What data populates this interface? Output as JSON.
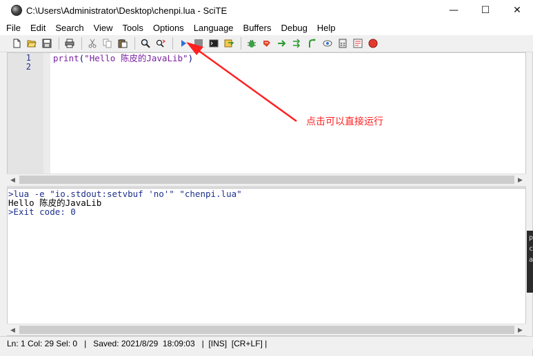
{
  "window": {
    "title": "C:\\Users\\Administrator\\Desktop\\chenpi.lua - SciTE",
    "minimize_glyph": "—",
    "maximize_glyph": "☐",
    "close_glyph": "✕"
  },
  "menu": {
    "items": [
      "File",
      "Edit",
      "Search",
      "View",
      "Tools",
      "Options",
      "Language",
      "Buffers",
      "Debug",
      "Help"
    ]
  },
  "toolbar": {
    "buttons": [
      "new-file-icon",
      "open-folder-icon",
      "save-icon",
      "print-icon",
      "cut-icon",
      "copy-icon",
      "paste-icon",
      "find-icon",
      "replace-icon",
      "run-icon",
      "stop-icon",
      "console-icon",
      "compile-icon",
      "build-icon",
      "go-icon",
      "next-message-icon",
      "jump-icon",
      "view-icon",
      "eye-icon",
      "calculator-icon",
      "macro-icon",
      "record-icon"
    ],
    "colors": {
      "run": "#2f6fd6",
      "stop": "#8a8a8a",
      "record": "#e23b2e",
      "bug": "#3aa245"
    }
  },
  "editor": {
    "line_numbers": [
      "1",
      "2"
    ],
    "code": {
      "keyword": "print",
      "open_paren": "(",
      "string": "\"Hello 陈皮的JavaLib\"",
      "close_paren": ")"
    }
  },
  "output": {
    "lines": [
      {
        "text": ">lua -e \"io.stdout:setvbuf 'no'\" \"chenpi.lua\"",
        "kind": "command"
      },
      {
        "text": "Hello 陈皮的JavaLib",
        "kind": "text"
      },
      {
        "text": ">Exit code: 0",
        "kind": "command"
      }
    ]
  },
  "statusbar": {
    "text": "Ln: 1 Col: 29 Sel: 0   |   Saved: 2021/8/29  18:09:03   |  [INS]  [CR+LF] |"
  },
  "annotation": {
    "text": "点击可以直接运行",
    "color": "#ff2020"
  },
  "background_window": {
    "glyphs": [
      "p",
      "c",
      "a"
    ]
  }
}
